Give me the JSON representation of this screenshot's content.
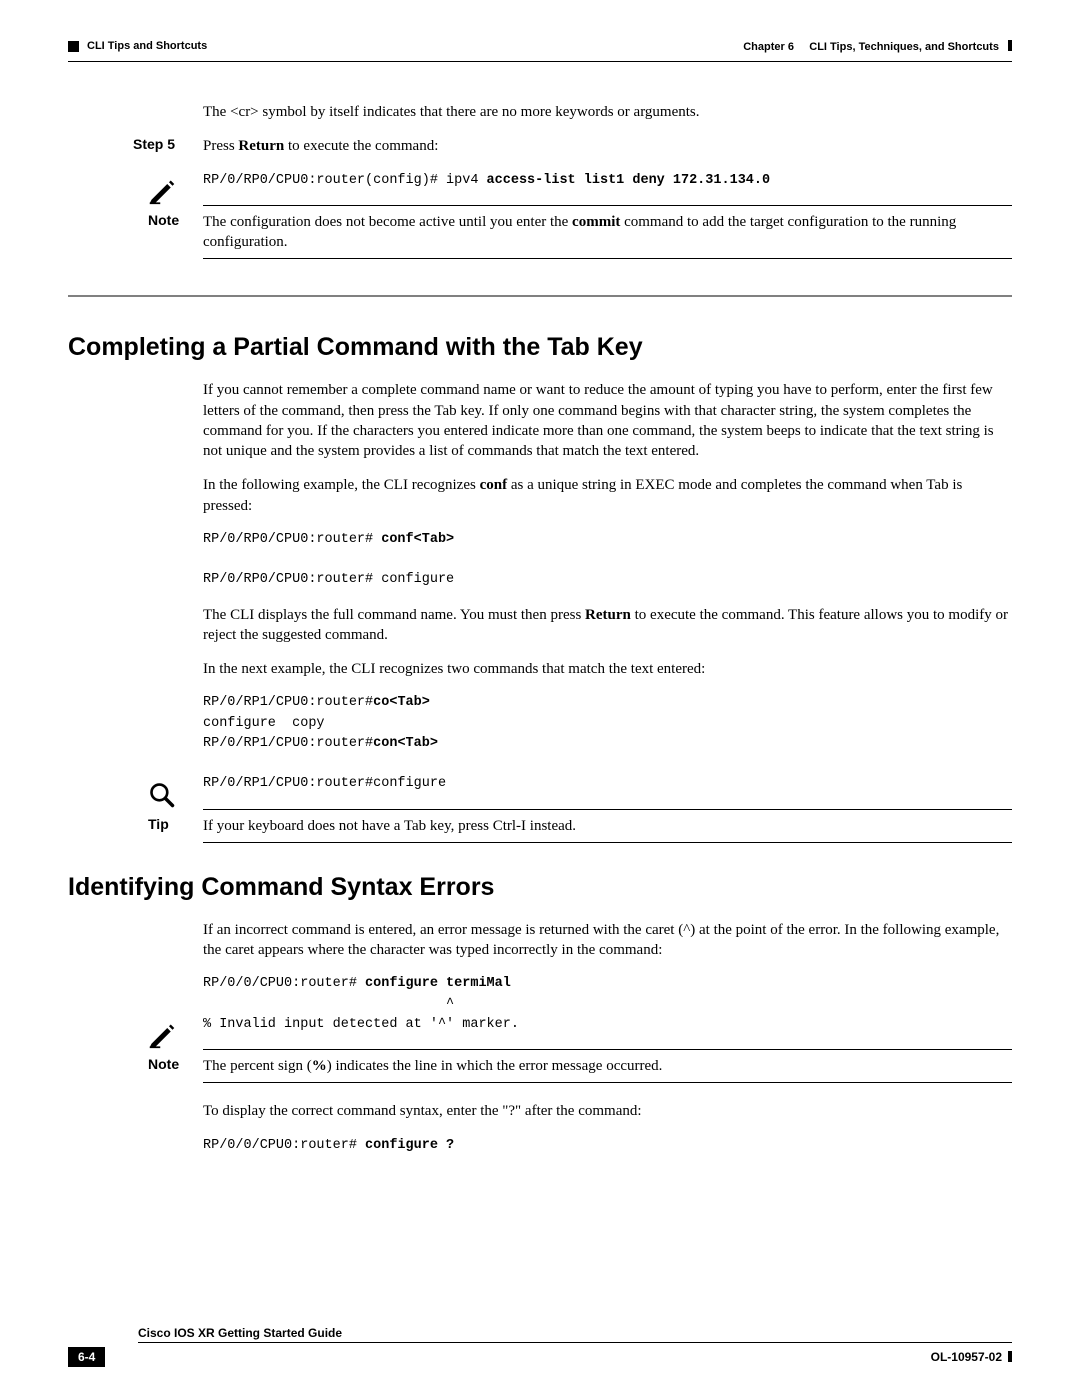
{
  "header": {
    "chapter_label": "Chapter 6",
    "chapter_title": "CLI Tips, Techniques, and Shortcuts",
    "section_title": "CLI Tips and Shortcuts"
  },
  "intro_line": "The <cr> symbol by itself indicates that there are no more keywords or arguments.",
  "step5": {
    "label": "Step 5",
    "text_prefix": "Press ",
    "text_bold": "Return",
    "text_suffix": " to execute the command:",
    "cli_prefix": "RP/0/RP0/CPU0:router(config)# ipv4 ",
    "cli_bold": "access-list list1 deny 172.31.134.0"
  },
  "note1": {
    "label": "Note",
    "text_prefix": "The configuration does not become active until you enter the ",
    "text_bold": "commit",
    "text_suffix": " command to add the target configuration to the running configuration."
  },
  "tab_section": {
    "heading": "Completing a Partial Command with the Tab Key",
    "para1": "If you cannot remember a complete command name or want to reduce the amount of typing you have to perform, enter the first few letters of the command, then press the Tab key. If only one command begins with that character string, the system completes the command for you. If the characters you entered indicate more than one command, the system beeps to indicate that the text string is not unique and the system provides a list of commands that match the text entered.",
    "para2_prefix": "In the following example, the CLI recognizes ",
    "para2_bold": "conf",
    "para2_suffix": " as a unique string in EXEC mode and completes the command when Tab is pressed:",
    "cli1_prefix": "RP/0/RP0/CPU0:router# ",
    "cli1_bold": "conf<Tab>",
    "cli1_line2": "RP/0/RP0/CPU0:router# configure",
    "para3_prefix": "The CLI displays the full command name. You must then press ",
    "para3_bold": "Return",
    "para3_suffix": " to execute the command. This feature allows you to modify or reject the suggested command.",
    "para4": "In the next example, the CLI recognizes two commands that match the text entered:",
    "cli2_l1_prefix": "RP/0/RP1/CPU0:router#",
    "cli2_l1_bold": "co<Tab>",
    "cli2_l2": "configure  copy",
    "cli2_l3_prefix": "RP/0/RP1/CPU0:router#",
    "cli2_l3_bold": "con<Tab>",
    "cli2_l4": "RP/0/RP1/CPU0:router#configure"
  },
  "tip1": {
    "label": "Tip",
    "text": "If your keyboard does not have a Tab key, press Ctrl-I instead."
  },
  "syntax_section": {
    "heading": "Identifying Command Syntax Errors",
    "para1": "If an incorrect command is entered, an error message is returned with the caret (^) at the point of the error. In the following example, the caret appears where the character was typed incorrectly in the command:",
    "cli1_prefix": "RP/0/0/CPU0:router# ",
    "cli1_bold": "configure termiMal",
    "cli1_caret": "                              ^",
    "cli1_err": "% Invalid input detected at '^' marker.",
    "note_label": "Note",
    "note_text_prefix": "The percent sign (",
    "note_text_bold": "%",
    "note_text_suffix": ") indicates the line in which the error message occurred.",
    "para2": "To display the correct command syntax, enter the \"?\" after the command:",
    "cli2_prefix": "RP/0/0/CPU0:router# ",
    "cli2_bold": "configure ?"
  },
  "footer": {
    "doc_title": "Cisco IOS XR Getting Started Guide",
    "page_num": "6-4",
    "doc_id": "OL-10957-02"
  }
}
